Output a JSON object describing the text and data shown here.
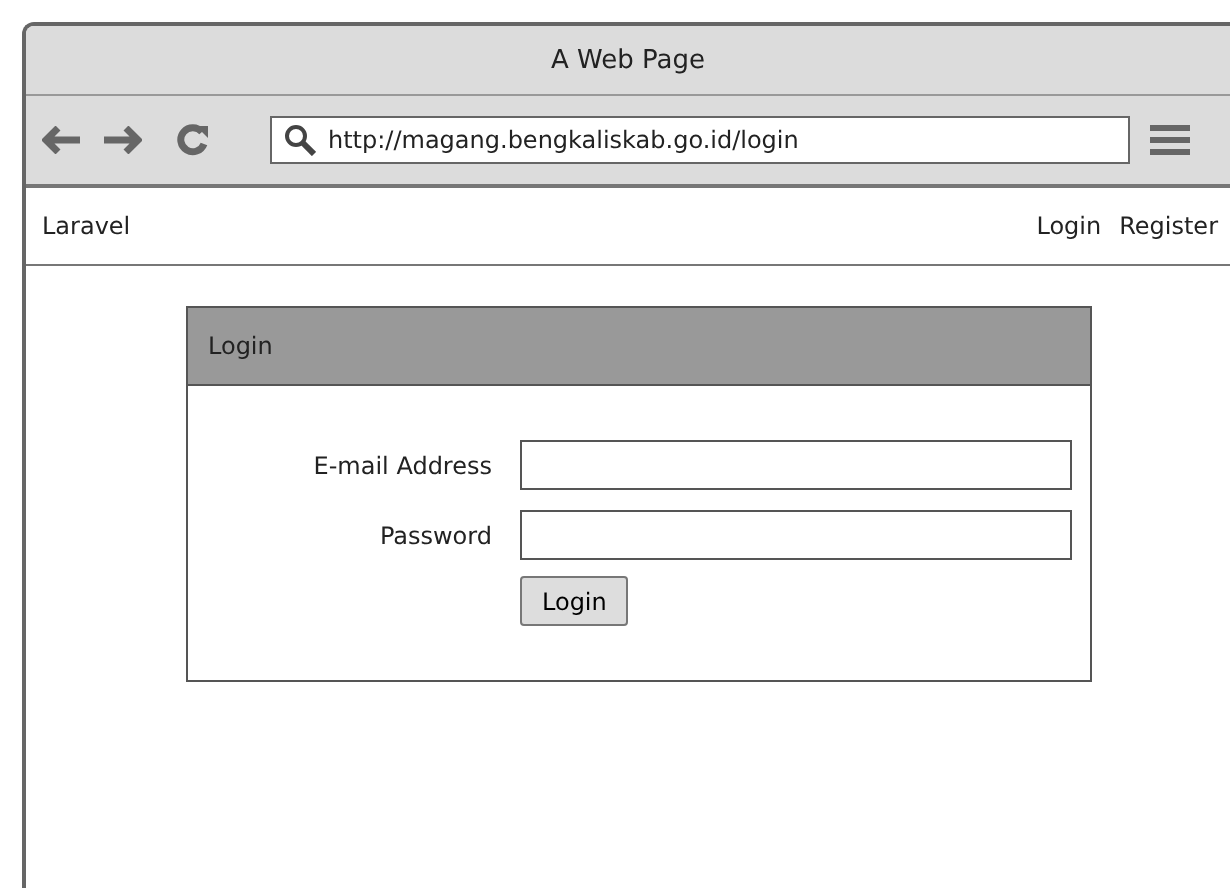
{
  "window": {
    "title": "A Web Page"
  },
  "address_bar": {
    "url": "http://magang.bengkaliskab.go.id/login"
  },
  "navbar": {
    "brand": "Laravel",
    "links": [
      "Login",
      "Register"
    ]
  },
  "login_card": {
    "title": "Login",
    "fields": [
      {
        "label": "E-mail Address"
      },
      {
        "label": "Password"
      }
    ],
    "button": "Login"
  }
}
